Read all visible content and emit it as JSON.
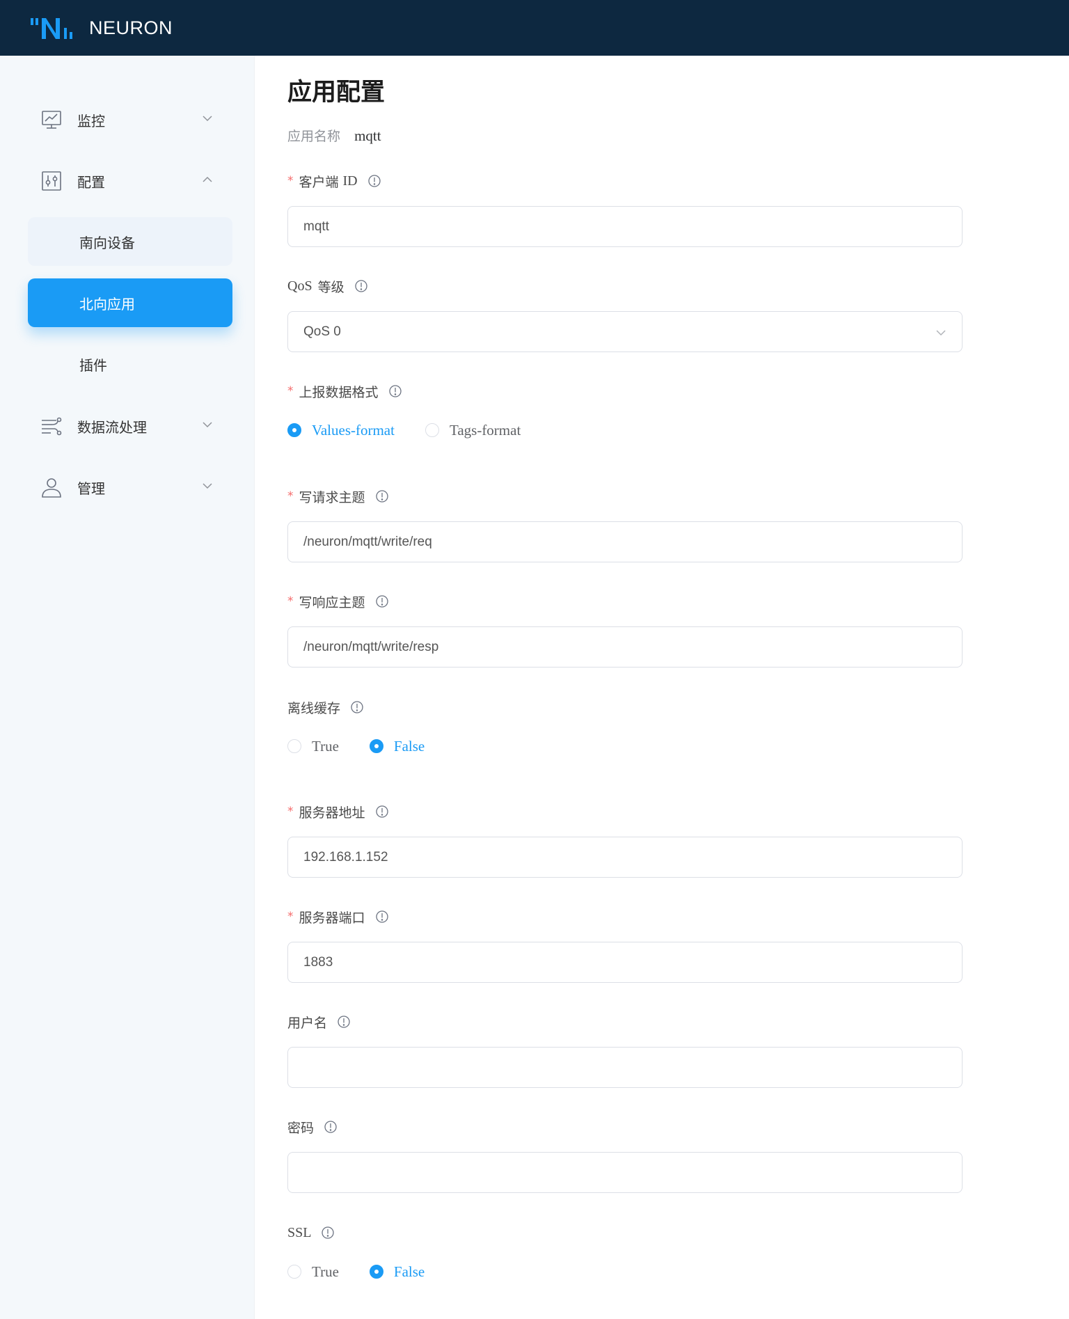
{
  "header": {
    "brand": "NEURON"
  },
  "sidebar": {
    "items": [
      {
        "label": "监控",
        "icon": "monitor-chart-icon",
        "expanded": false
      },
      {
        "label": "配置",
        "icon": "config-sliders-icon",
        "expanded": true,
        "children": [
          {
            "label": "南向设备",
            "state": "hover"
          },
          {
            "label": "北向应用",
            "state": "active"
          },
          {
            "label": "插件",
            "state": "normal"
          }
        ]
      },
      {
        "label": "数据流处理",
        "icon": "data-flow-icon",
        "expanded": false
      },
      {
        "label": "管理",
        "icon": "user-icon",
        "expanded": false
      }
    ]
  },
  "page": {
    "title": "应用配置",
    "app_name_label": "应用名称",
    "app_name_value": "mqtt"
  },
  "form": {
    "client_id": {
      "label_cn": "客户端",
      "label_en": "ID",
      "required": true,
      "value": "mqtt"
    },
    "qos": {
      "label_en": "QoS",
      "label_cn": "等级",
      "required": false,
      "value": "QoS 0"
    },
    "upload_format": {
      "label": "上报数据格式",
      "required": true,
      "options": [
        "Values-format",
        "Tags-format"
      ],
      "selected": "Values-format"
    },
    "write_req_topic": {
      "label": "写请求主题",
      "required": true,
      "value": "/neuron/mqtt/write/req"
    },
    "write_resp_topic": {
      "label": "写响应主题",
      "required": true,
      "value": "/neuron/mqtt/write/resp"
    },
    "offline_cache": {
      "label": "离线缓存",
      "required": false,
      "options": [
        "True",
        "False"
      ],
      "selected": "False"
    },
    "server_host": {
      "label": "服务器地址",
      "required": true,
      "value": "192.168.1.152"
    },
    "server_port": {
      "label": "服务器端口",
      "required": true,
      "value": "1883"
    },
    "username": {
      "label": "用户名",
      "required": false,
      "value": ""
    },
    "password": {
      "label": "密码",
      "required": false,
      "value": ""
    },
    "ssl": {
      "label": "SSL",
      "required": false,
      "options": [
        "True",
        "False"
      ],
      "selected": "False"
    }
  },
  "colors": {
    "header_bg": "#0d2840",
    "accent": "#1a9bf5",
    "required": "#f56c6c",
    "sidebar_bg": "#f4f8fb"
  }
}
